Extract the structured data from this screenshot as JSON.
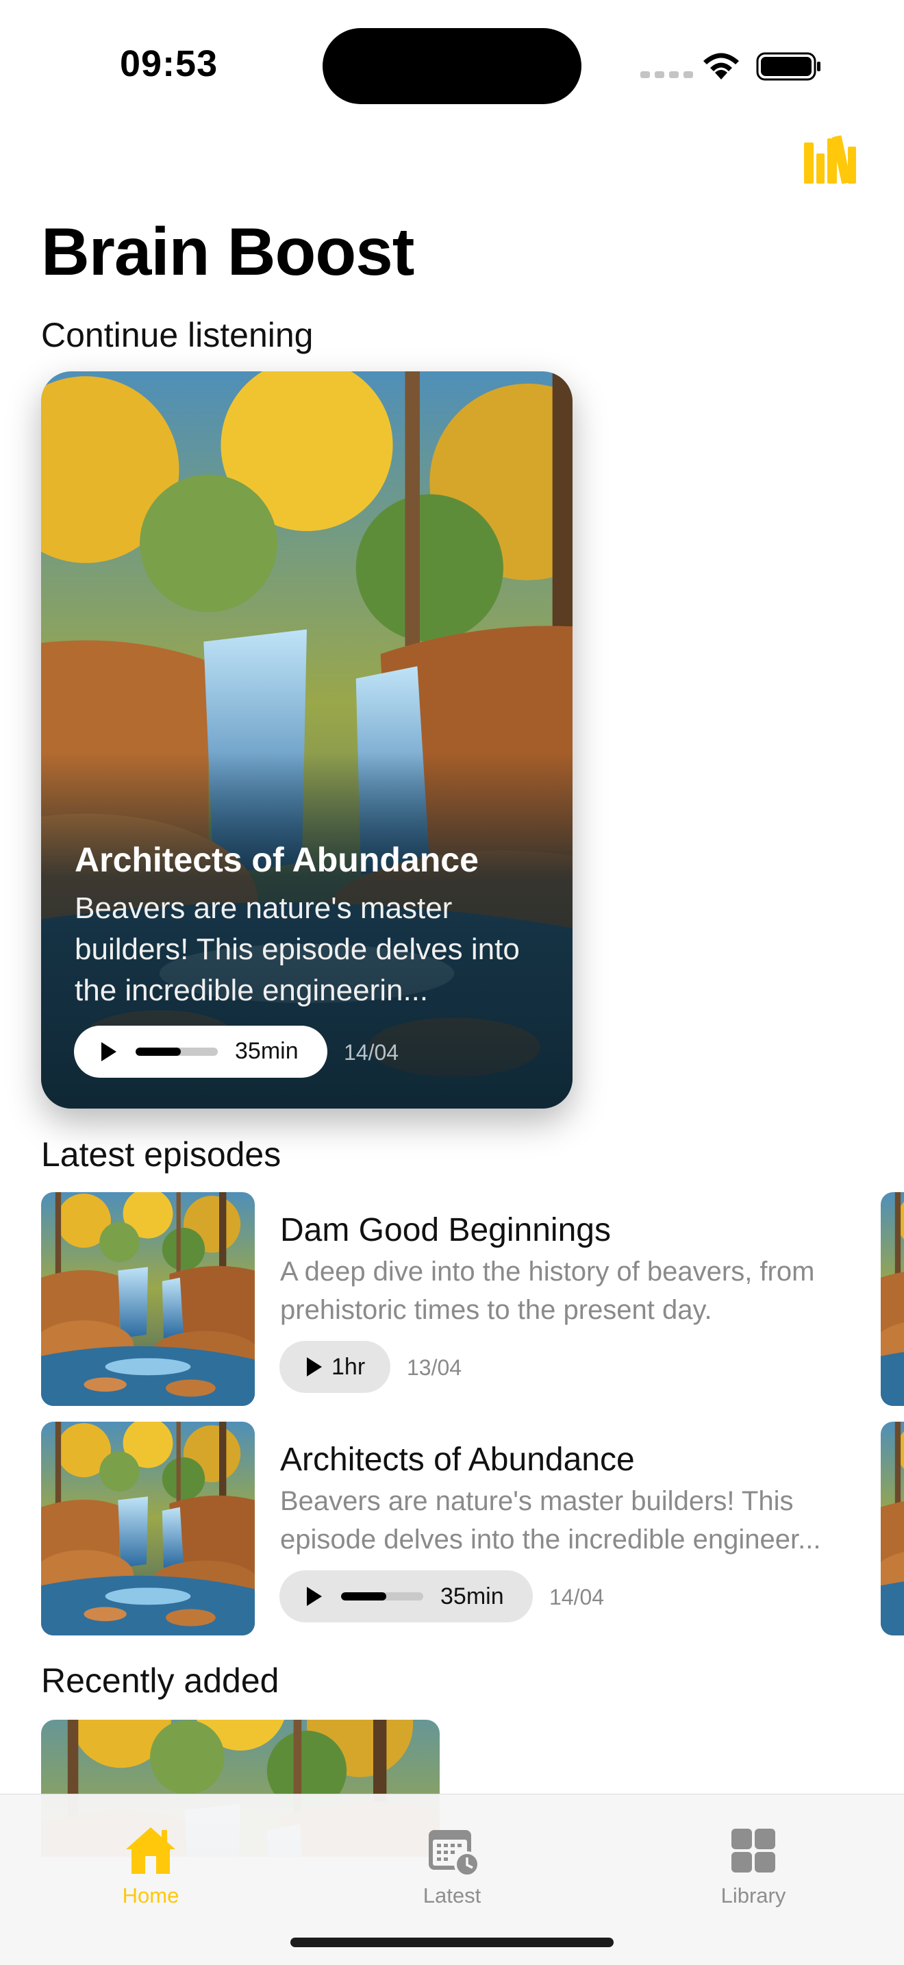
{
  "status": {
    "time": "09:53"
  },
  "header": {
    "title": "Brain Boost",
    "library_icon": "bookshelf-icon",
    "accent_color": "#FFC80A"
  },
  "continue_listening": {
    "section_title": "Continue listening",
    "card": {
      "title": "Architects of Abundance",
      "description": "Beavers are nature's master builders! This episode delves into the incredible engineerin...",
      "duration": "35min",
      "date": "14/04",
      "progress": 0.55
    }
  },
  "latest_episodes": {
    "section_title": "Latest episodes",
    "items": [
      {
        "title": "Dam Good Beginnings",
        "description": "A deep dive into the history of beavers, from prehistoric times to the present day.",
        "duration": "1hr",
        "date": "13/04",
        "progress": 0
      },
      {
        "title": "Architects of Abundance",
        "description": "Beavers are nature's master builders! This episode delves into the incredible engineer...",
        "duration": "35min",
        "date": "14/04",
        "progress": 0.55
      }
    ]
  },
  "recently_added": {
    "section_title": "Recently added"
  },
  "tab_bar": {
    "tabs": [
      {
        "label": "Home",
        "icon": "house-icon",
        "active": true
      },
      {
        "label": "Latest",
        "icon": "calendar-clock-icon",
        "active": false
      },
      {
        "label": "Library",
        "icon": "grid-icon",
        "active": false
      }
    ]
  }
}
